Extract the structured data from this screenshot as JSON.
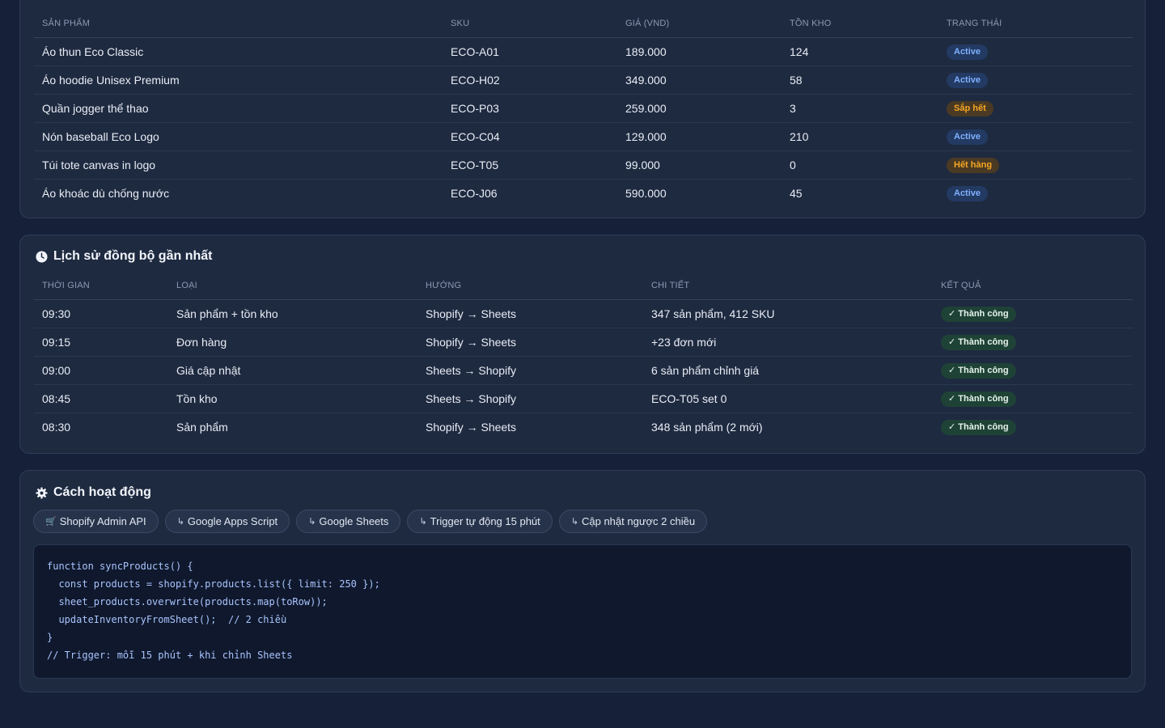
{
  "products": {
    "columns": [
      "SẢN PHẨM",
      "SKU",
      "GIÁ (VND)",
      "TỒN KHO",
      "TRẠNG THÁI"
    ],
    "rows": [
      {
        "name": "Áo thun Eco Classic",
        "sku": "ECO-A01",
        "price": "189.000",
        "stock": "124",
        "status": "Active",
        "status_kind": "active"
      },
      {
        "name": "Áo hoodie Unisex Premium",
        "sku": "ECO-H02",
        "price": "349.000",
        "stock": "58",
        "status": "Active",
        "status_kind": "active"
      },
      {
        "name": "Quần jogger thể thao",
        "sku": "ECO-P03",
        "price": "259.000",
        "stock": "3",
        "status": "Sắp hết",
        "status_kind": "low"
      },
      {
        "name": "Nón baseball Eco Logo",
        "sku": "ECO-C04",
        "price": "129.000",
        "stock": "210",
        "status": "Active",
        "status_kind": "active"
      },
      {
        "name": "Túi tote canvas in logo",
        "sku": "ECO-T05",
        "price": "99.000",
        "stock": "0",
        "status": "Hết hàng",
        "status_kind": "out"
      },
      {
        "name": "Áo khoác dù chống nước",
        "sku": "ECO-J06",
        "price": "590.000",
        "stock": "45",
        "status": "Active",
        "status_kind": "active"
      }
    ]
  },
  "history": {
    "title": "Lịch sử đồng bộ gần nhất",
    "icon": "clock-icon",
    "columns": [
      "THỜI GIAN",
      "LOẠI",
      "HƯỚNG",
      "CHI TIẾT",
      "KẾT QUẢ"
    ],
    "rows": [
      {
        "time": "09:30",
        "type": "Sản phẩm + tồn kho",
        "direction": "Shopify → Sheets",
        "detail": "347 sản phẩm, 412 SKU",
        "result": "✓ Thành công"
      },
      {
        "time": "09:15",
        "type": "Đơn hàng",
        "direction": "Shopify → Sheets",
        "detail": "+23 đơn mới",
        "result": "✓ Thành công"
      },
      {
        "time": "09:00",
        "type": "Giá cập nhật",
        "direction": "Sheets → Shopify",
        "detail": "6 sản phẩm chỉnh giá",
        "result": "✓ Thành công"
      },
      {
        "time": "08:45",
        "type": "Tồn kho",
        "direction": "Sheets → Shopify",
        "detail": "ECO-T05 set 0",
        "result": "✓ Thành công"
      },
      {
        "time": "08:30",
        "type": "Sản phẩm",
        "direction": "Shopify → Sheets",
        "detail": "348 sản phẩm (2 mới)",
        "result": "✓ Thành công"
      }
    ]
  },
  "how": {
    "title": "Cách hoạt động",
    "icon": "gear-icon",
    "chips": [
      {
        "icon": "🛒",
        "label": "Shopify Admin API"
      },
      {
        "icon": "↳",
        "label": "Google Apps Script"
      },
      {
        "icon": "↳",
        "label": "Google Sheets"
      },
      {
        "icon": "↳",
        "label": "Trigger tự động 15 phút"
      },
      {
        "icon": "↳",
        "label": "Cập nhật ngược 2 chiều"
      }
    ],
    "code": "function syncProducts() {\n  const products = shopify.products.list({ limit: 250 });\n  sheet_products.overwrite(products.map(toRow));\n  updateInventoryFromSheet();  // 2 chiều\n}\n// Trigger: mỗi 15 phút + khi chỉnh Sheets"
  },
  "colors": {
    "background": "#162038",
    "card": "#1e2a40",
    "active_badge": "#7fb0ff",
    "warning_badge": "#f5a623",
    "success_badge": "#1f4236"
  }
}
